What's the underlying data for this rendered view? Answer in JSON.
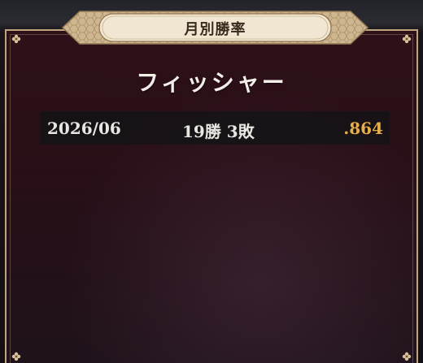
{
  "dialog": {
    "title": "月別勝率"
  },
  "player": {
    "name": "フィッシャー"
  },
  "records": [
    {
      "month": "2026/06",
      "win_loss": "19勝 3敗",
      "rate": ".864"
    }
  ],
  "colors": {
    "panel_border": "#bfa57f",
    "panel_bg": "#2a0f17",
    "title_banner": "#f1e6d2",
    "title_text": "#3a2a1e",
    "rate_text": "#e6ae4a",
    "row_bg": "#141416"
  },
  "icons": {
    "corner": "flower-ornament-icon",
    "banner": "hexagon-pattern-icon"
  }
}
